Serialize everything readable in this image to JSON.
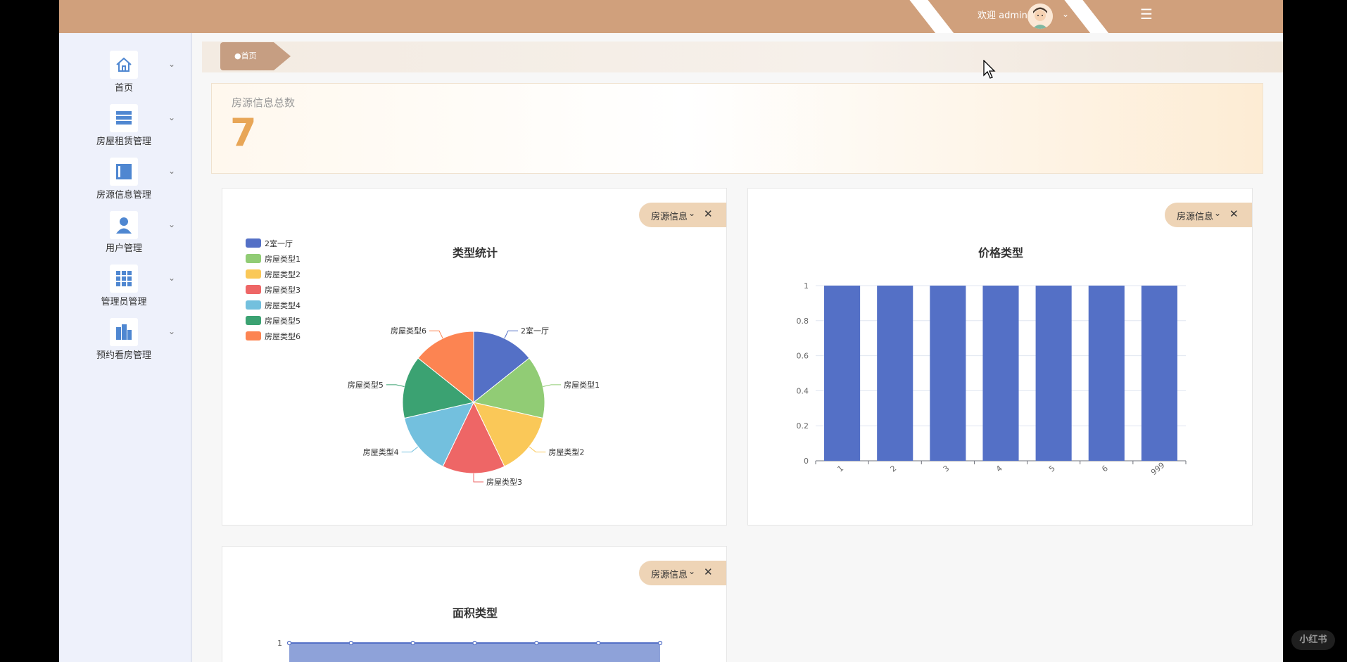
{
  "header": {
    "welcome": "欢迎 admin",
    "bg_color": "#d0a07c"
  },
  "sidebar": {
    "items": [
      {
        "label": "首页",
        "icon": "home-icon"
      },
      {
        "label": "房屋租赁管理",
        "icon": "list-icon"
      },
      {
        "label": "房源信息管理",
        "icon": "book-icon"
      },
      {
        "label": "用户管理",
        "icon": "user-icon"
      },
      {
        "label": "管理员管理",
        "icon": "grid-icon"
      },
      {
        "label": "预约看房管理",
        "icon": "building-icon"
      }
    ]
  },
  "breadcrumb": {
    "label": "●首页"
  },
  "summary": {
    "label": "房源信息总数",
    "value": "7"
  },
  "card_tag": {
    "label": "房源信息"
  },
  "watermark": "小红书",
  "colors": {
    "accent": "#d0a07c",
    "bar": "#5470c6",
    "total": "#e8a657"
  },
  "chart_data": [
    {
      "type": "pie",
      "title": "类型统计",
      "categories": [
        "2室一厅",
        "房屋类型1",
        "房屋类型2",
        "房屋类型3",
        "房屋类型4",
        "房屋类型5",
        "房屋类型6"
      ],
      "values": [
        1,
        1,
        1,
        1,
        1,
        1,
        1
      ],
      "colors": [
        "#5470c6",
        "#91cc75",
        "#fac858",
        "#ee6666",
        "#73c0de",
        "#3ba272",
        "#fc8452"
      ],
      "legend": "top-left"
    },
    {
      "type": "bar",
      "title": "价格类型",
      "categories": [
        "1",
        "2",
        "3",
        "4",
        "5",
        "6",
        "999"
      ],
      "values": [
        1,
        1,
        1,
        1,
        1,
        1,
        1
      ],
      "ylim": [
        0,
        1
      ],
      "yticks": [
        "0",
        "0.2",
        "0.4",
        "0.6",
        "0.8",
        "1"
      ],
      "grid": true
    },
    {
      "type": "area",
      "title": "面积类型",
      "values": [
        1,
        1,
        1,
        1,
        1,
        1,
        1
      ],
      "yticks_visible": [
        "1"
      ]
    }
  ]
}
